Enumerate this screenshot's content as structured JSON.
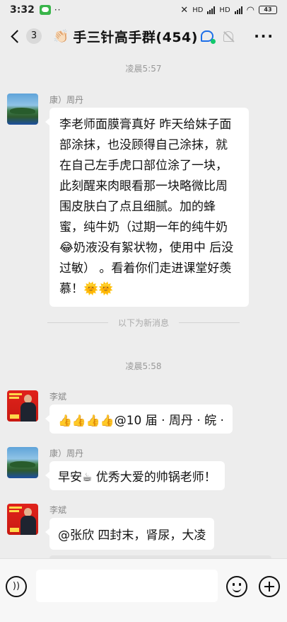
{
  "status_bar": {
    "time": "3:32",
    "dots": "··",
    "net_labels": "HD",
    "battery": "43"
  },
  "nav": {
    "unread_count": "3",
    "group_emoji": "👏🏻",
    "group_title": "手三针高手群(454)",
    "more": "···"
  },
  "chat": {
    "timestamps": [
      "凌晨5:57",
      "凌晨5:58"
    ],
    "divider_text": "以下为新消息",
    "messages": [
      {
        "sender": "康）周丹",
        "text": "李老师面膜膏真好  昨天给妹子面部涂抹，也没顾得自己涂抹，就在自己左手虎口部位涂了一块，此刻醒来肉眼看那一块略微比周围皮肤白了点且细腻。加的蜂蜜，纯牛奶（过期一年的纯牛奶😂奶液没有絮状物，使用中  后没过敏）  。看着你们走进课堂好羡慕！🌞🌞"
      },
      {
        "sender": "李斌",
        "thumbs": "👍👍👍👍",
        "text": "@10 届 · 周丹 · 皖 ·"
      },
      {
        "sender": "康）周丹",
        "text_a": "早安",
        "coffee": "☕",
        "text_b": " 优秀大爱的帅锅老师！"
      },
      {
        "sender": "李斌",
        "text": "@张欣  四封末，肾尿，大凌"
      }
    ]
  },
  "input_bar": {
    "voice_glyph": "))",
    "input_value": ""
  }
}
